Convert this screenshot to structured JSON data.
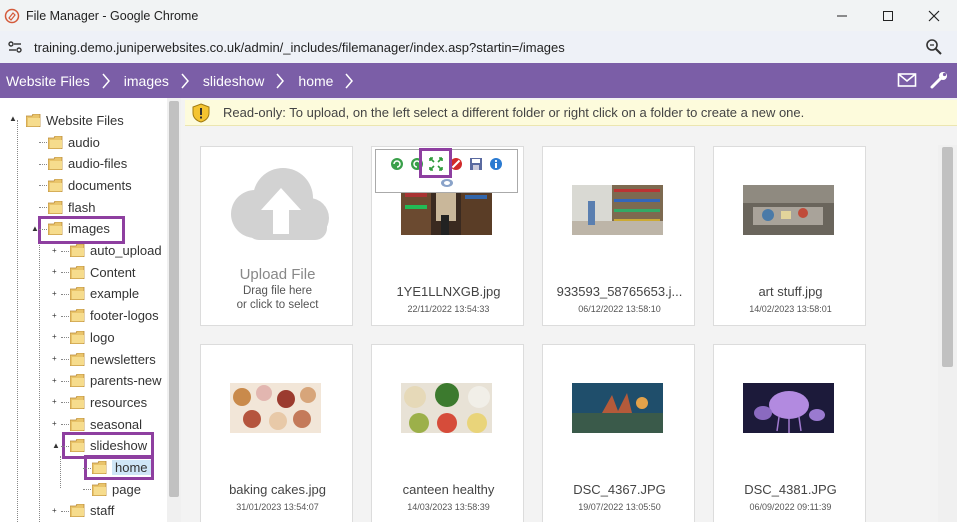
{
  "window": {
    "title": "File Manager - Google Chrome",
    "url": "training.demo.juniperwebsites.co.uk/admin/_includes/filemanager/index.asp?startin=/images"
  },
  "breadcrumb": [
    "Website Files",
    "images",
    "slideshow",
    "home"
  ],
  "colors": {
    "brand": "#7b5ea7",
    "highlight": "#8e3fa0",
    "notice": "#fdfbdc"
  },
  "tree": {
    "root": "Website Files",
    "items": [
      "audio",
      "audio-files",
      "documents",
      "flash",
      "images"
    ],
    "images_children": [
      "auto_upload",
      "Content",
      "example",
      "footer-logos",
      "logo",
      "newsletters",
      "parents-new",
      "resources",
      "seasonal",
      "slideshow"
    ],
    "slideshow_children": [
      "home",
      "page"
    ],
    "tail": [
      "staff"
    ]
  },
  "notice": "Read-only: To upload, on the left select a different folder or right click on a folder to create a new one.",
  "upload": {
    "title": "Upload File",
    "line1": "Drag file here",
    "line2": "or click to select"
  },
  "files": [
    {
      "name": "1YE1LLNXGB.jpg",
      "date": "22/11/2022 13:54:33"
    },
    {
      "name": "933593_58765653.j...",
      "date": "06/12/2022 13:58:10"
    },
    {
      "name": "art stuff.jpg",
      "date": "14/02/2023 13:58:01"
    },
    {
      "name": "baking cakes.jpg",
      "date": "31/01/2023 13:54:07"
    },
    {
      "name": "canteen healthy",
      "date": "14/03/2023 13:58:39"
    },
    {
      "name": "DSC_4367.JPG",
      "date": "19/07/2022 13:05:50"
    },
    {
      "name": "DSC_4381.JPG",
      "date": "06/09/2022 09:11:39"
    }
  ]
}
